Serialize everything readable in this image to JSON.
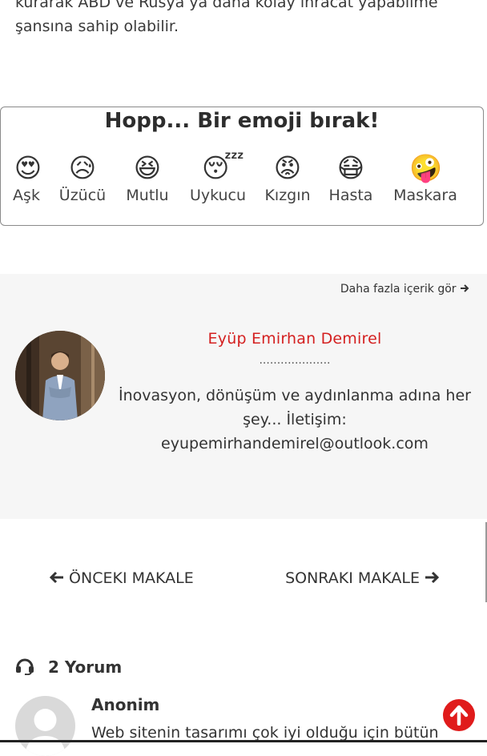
{
  "article": {
    "intro_line1": "kurarak ABD ve Rusya’ya daha kolay ihracat yapabilme",
    "intro_line2": "şansına sahip olabilir."
  },
  "emoji_box": {
    "title": "Hopp... Bir emoji bırak!",
    "items": [
      {
        "label": "Aşk",
        "glyph": "😍"
      },
      {
        "label": "Üzücü",
        "glyph": "😥"
      },
      {
        "label": "Mutlu",
        "glyph": "😆"
      },
      {
        "label": "Uykucu",
        "glyph": "😴"
      },
      {
        "label": "Kızgın",
        "glyph": "😡"
      },
      {
        "label": "Hasta",
        "glyph": "😷"
      },
      {
        "label": "Maskara",
        "glyph": "🤪"
      }
    ]
  },
  "author_box": {
    "more_link": "Daha fazla içerik gör",
    "name": "Eyüp Emirhan Demirel",
    "dots": "....................",
    "bio": "İnovasyon, dönüşüm ve aydınlanma adına her şey... İletişim: eyupemirhandemirel@outlook.com"
  },
  "post_nav": {
    "prev": "ÖNCEKI MAKALE",
    "next": "SONRAKI MAKALE"
  },
  "comments": {
    "count_label": "2 Yorum",
    "items": [
      {
        "author": "Anonim",
        "text": "Web sitenin tasarımı çok iyi olduğu için bütün"
      }
    ]
  },
  "colors": {
    "accent_red": "#d42020",
    "scroll_top_bg": "#e01b1b",
    "author_bg": "#f6f6f6"
  },
  "icons": {
    "more_link": "arrow-right-icon",
    "prev": "arrow-left-icon",
    "next": "arrow-right-icon",
    "comments": "comments-headset-icon",
    "scroll_top": "arrow-up-circle-icon"
  }
}
